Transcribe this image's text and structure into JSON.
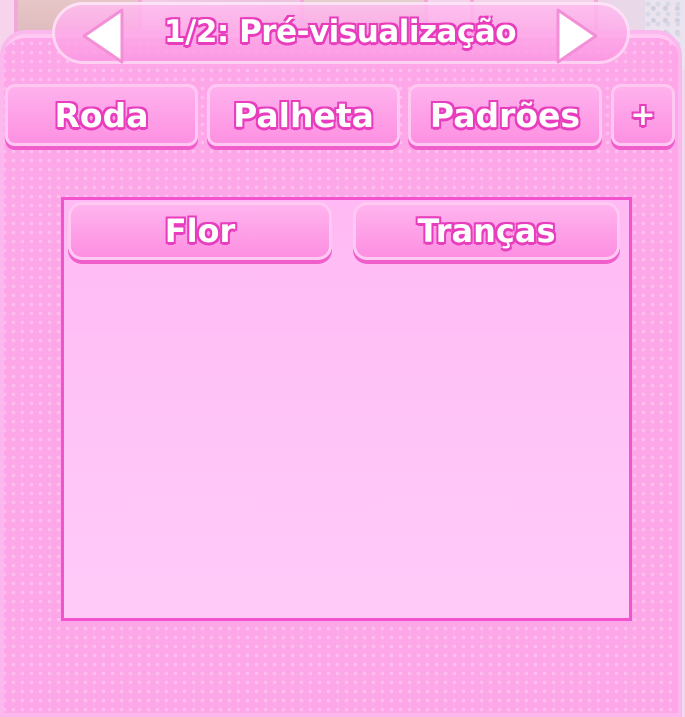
{
  "header": {
    "title": "1/2: Pré-visualização",
    "prev_icon": "triangle-left-arrow",
    "next_icon": "triangle-right-arrow"
  },
  "tabs": [
    {
      "label": "Roda"
    },
    {
      "label": "Palheta"
    },
    {
      "label": "Padrões"
    },
    {
      "label": "+"
    }
  ],
  "content": {
    "buttons": [
      {
        "label": "Flor"
      },
      {
        "label": "Tranças"
      }
    ]
  },
  "colors": {
    "panel": "#fda6e8",
    "accent_outline": "#e83dbd",
    "content_border": "#f453cf",
    "content_fill": "#ffc4f7"
  }
}
